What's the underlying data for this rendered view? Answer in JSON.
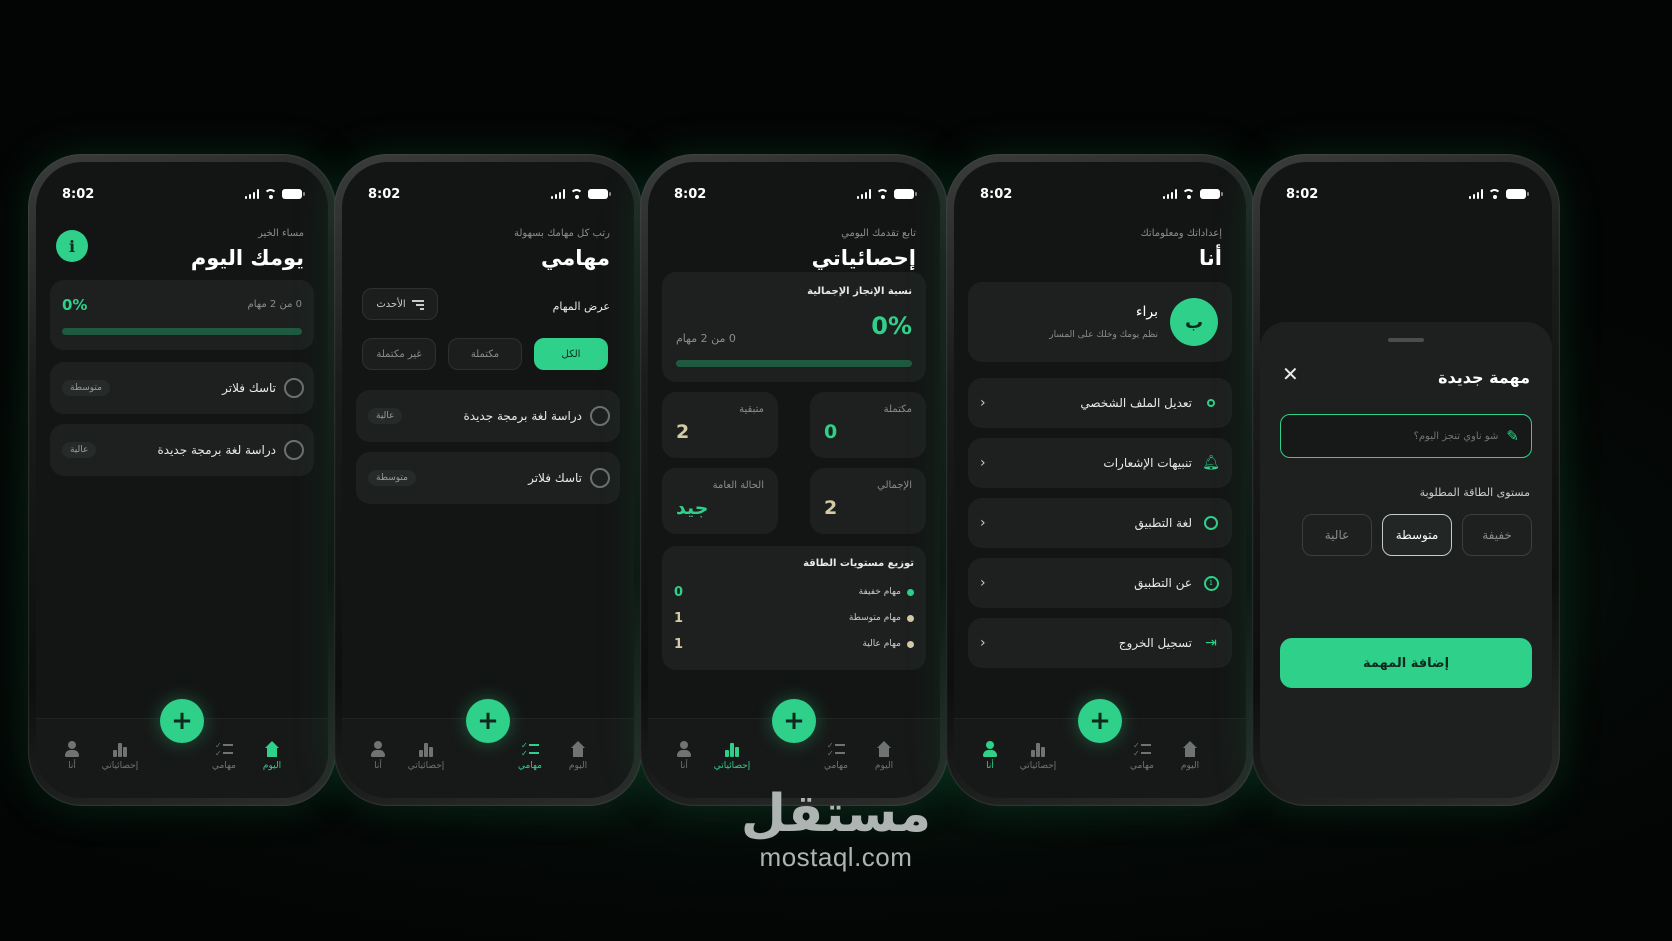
{
  "status_time": "8:02",
  "nav": {
    "me": "أنا",
    "stats": "إحصائياتي",
    "tasks": "مهامي",
    "today": "اليوم",
    "fab": "+"
  },
  "screen1": {
    "subtitle": "مساء الخير",
    "title": "يومك اليوم",
    "info_badge": "i",
    "percent": "0%",
    "count": "0 من 2 مهام",
    "tasks": [
      {
        "name": "تاسك فلاتر",
        "priority": "متوسطة"
      },
      {
        "name": "دراسة لغة برمجة جديدة",
        "priority": "عالية"
      }
    ]
  },
  "screen2": {
    "subtitle": "رتب كل مهامك بسهولة",
    "title": "مهامي",
    "view_label": "عرض المهام",
    "sort_label": "الأحدث",
    "tabs": [
      "الكل",
      "مكتملة",
      "غير مكتملة"
    ],
    "tasks": [
      {
        "name": "دراسة لغة برمجة جديدة",
        "priority": "عالية"
      },
      {
        "name": "تاسك فلاتر",
        "priority": "متوسطة"
      }
    ]
  },
  "screen3": {
    "subtitle": "تابع تقدمك اليومي",
    "title": "إحصائياتي",
    "overall_label": "نسبة الإنجاز الإجمالية",
    "percent": "0%",
    "count": "0 من 2 مهام",
    "stats": {
      "completed_label": "مكتملة",
      "completed_value": "0",
      "remaining_label": "متبقية",
      "remaining_value": "2",
      "total_label": "الإجمالي",
      "total_value": "2",
      "status_label": "الحالة العامة",
      "status_value": "جيد"
    },
    "distribution_title": "توزيع مستويات الطاقة",
    "distribution": [
      {
        "label": "مهام خفيفة",
        "value": "0",
        "color": "#2ed08a"
      },
      {
        "label": "مهام متوسطة",
        "value": "1",
        "color": "#d6c9a8"
      },
      {
        "label": "مهام عالية",
        "value": "1",
        "color": "#d6c9a8"
      }
    ]
  },
  "screen4": {
    "subtitle": "إعداداتك ومعلوماتك",
    "title": "أنا",
    "avatar_letter": "ب",
    "user_name": "براء",
    "user_tagline": "نظم يومك وخلك على المسار",
    "menu": [
      "تعديل الملف الشخصي",
      "تنبيهات الإشعارات",
      "لغة التطبيق",
      "عن التطبيق",
      "تسجيل الخروج"
    ]
  },
  "screen5": {
    "sheet_title": "مهمة جديدة",
    "input_placeholder": "شو ناوي تنجز اليوم؟",
    "energy_label": "مستوى الطاقة المطلوبة",
    "energy_options": [
      "خفيفة",
      "متوسطة",
      "عالية"
    ],
    "selected_energy": "متوسطة",
    "submit": "إضافة المهمة"
  },
  "watermark": {
    "logo": "مستقل",
    "url": "mostaql.com"
  },
  "colors": {
    "accent": "#2ed08a",
    "background": "#131514",
    "card": "#1d201f"
  }
}
